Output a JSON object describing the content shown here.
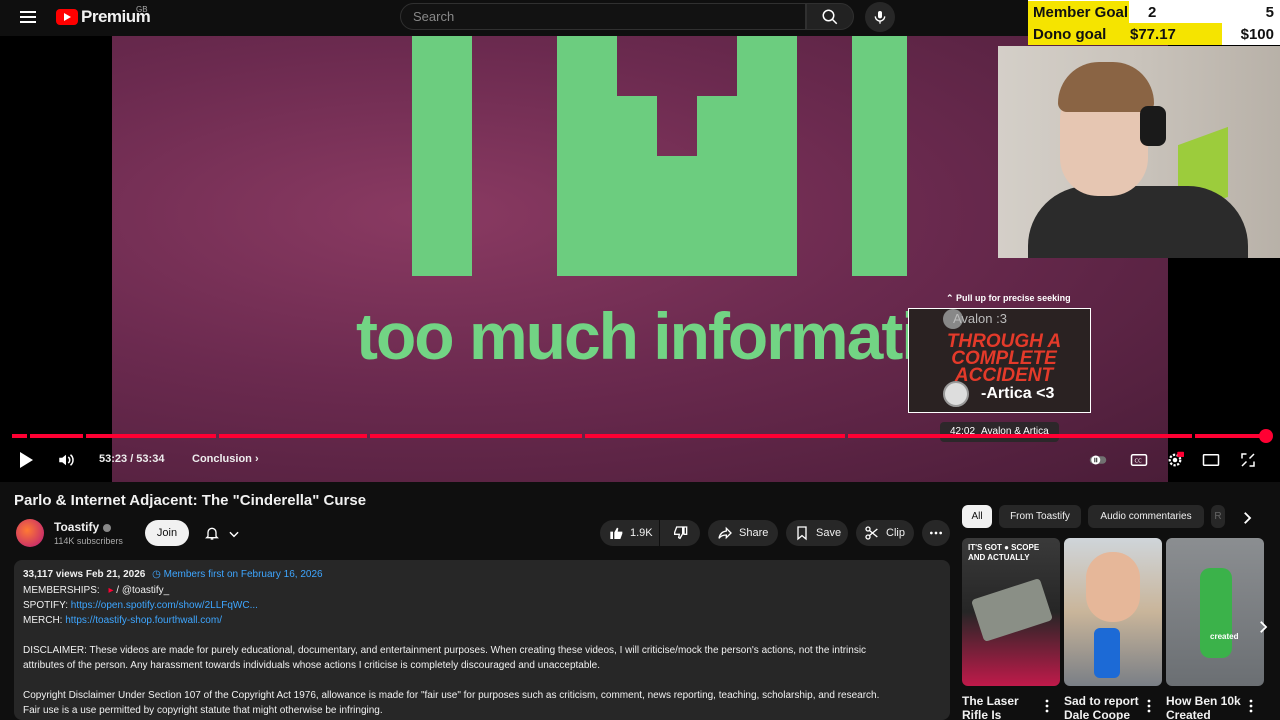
{
  "header": {
    "brand": "Premium",
    "region": "GB",
    "search_placeholder": "Search"
  },
  "stream_overlay": {
    "member_goal_label": "Member Goal",
    "member_goal_current": "2",
    "member_goal_target": "5",
    "member_goal_progress": 0.4,
    "dono_goal_label": "Dono goal",
    "dono_goal_current": "$77.17",
    "dono_goal_target": "$100",
    "dono_goal_progress": 0.7717
  },
  "player": {
    "frame_text": "too much information",
    "seek_hint": "⌃ Pull up for precise seeking",
    "preview_top": "Avalon :3",
    "preview_title": "THROUGH A COMPLETE ACCIDENT",
    "preview_bottom": "-Artica <3",
    "preview_time": "42:02",
    "preview_chapter": "Avalon & Artica",
    "time_display": "53:23 / 53:34",
    "current_chapter": "Conclusion",
    "played_fraction": 0.9965,
    "colors": {
      "progress": "#ff0033",
      "accent": "#3ea6ff"
    }
  },
  "video": {
    "title": "Parlo & Internet Adjacent: The \"Cinderella\" Curse",
    "channel_name": "Toastify",
    "subscribers": "114K subscribers",
    "join_label": "Join",
    "likes": "1.9K",
    "share_label": "Share",
    "save_label": "Save",
    "clip_label": "Clip"
  },
  "description": {
    "views_date": "33,117 views  Feb 21, 2026",
    "members_first": "Members first on February 16, 2026",
    "memberships_label": "MEMBERSHIPS:",
    "memberships_value": " / @toastify_",
    "spotify_label": "SPOTIFY:",
    "spotify_link": "https://open.spotify.com/show/2LLFqWC...",
    "merch_label": "MERCH:",
    "merch_link": "https://toastify-shop.fourthwall.com/",
    "disclaimer_1": "DISCLAIMER: These videos are made for purely educational, documentary, and entertainment purposes. When creating these videos, I will criticise/mock the person's actions, not the intrinsic",
    "disclaimer_2": "attributes of the person. Any harassment towards individuals whose actions I criticise is completely discouraged and unacceptable.",
    "copyright_1": "Copyright Disclaimer Under Section 107 of the Copyright Act 1976, allowance is made for \"fair use\" for purposes such as criticism, comment, news reporting, teaching, scholarship, and research.",
    "copyright_2": "Fair use is a use permitted by copyright statute that might otherwise be infringing."
  },
  "sidebar": {
    "chips": [
      "All",
      "From Toastify",
      "Audio commentaries",
      "R"
    ],
    "videos": [
      {
        "title": "The Laser Rifle Is",
        "thumb_text": "IT'S GOT ● SCOPE AND ACTUALLY"
      },
      {
        "title": "Sad to report Dale Coope",
        "thumb_text": ""
      },
      {
        "title": "How Ben 10k Created",
        "thumb_text": "created"
      }
    ]
  }
}
